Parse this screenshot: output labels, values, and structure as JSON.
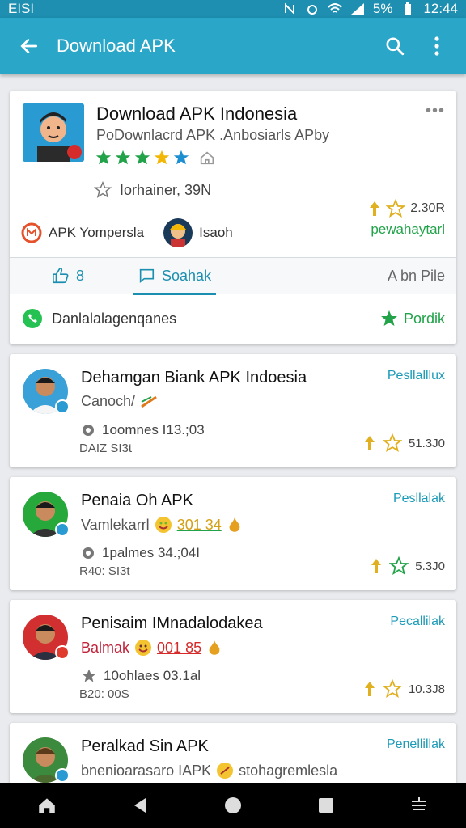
{
  "status": {
    "carrier": "ЕISI",
    "battery": "5%",
    "time": "12:44"
  },
  "appbar": {
    "title": "Download APK",
    "back_icon": "arrow-left-icon",
    "search_icon": "search-icon",
    "menu_icon": "more-vert-icon"
  },
  "featured": {
    "title": "Download APK Indonesia",
    "subtitle": "PoDownlacrd APK .Anbosiarls APby",
    "rating_stars": 5,
    "more": "•••",
    "follow_label": "Iorhainer, 39N",
    "developer1": "APK Yompersla",
    "developer2": "Isaoh",
    "stat_value": "2.30R",
    "stat_sub": "pewahaytarl",
    "tabs": [
      {
        "label": "8"
      },
      {
        "label": "Soahak"
      },
      {
        "label": "A bn Pile"
      }
    ],
    "bottom_label": "Danlalalagenqanes",
    "bottom_action": "Pordik"
  },
  "items": [
    {
      "name": "Dehamgan Biank APK Indoesia",
      "line2": "Canoch/",
      "line2_colored": "",
      "meta1": "1oomnes I13.;03",
      "meta2": "DAIZ SI3t",
      "link": "Pesllalllux",
      "stat": "51.3J0",
      "badge_color": "#2a9ad3",
      "accent": "#22a34a"
    },
    {
      "name": "Penaia Oh APK",
      "line2": "Vamlekarrl",
      "line2_colored": "301 34",
      "meta1": "1palmes 34.;04I",
      "meta2": "R40: SI3t",
      "link": "Pesllalak",
      "stat": "5.3J0",
      "badge_color": "#2a9ad3",
      "accent": "#d4a017"
    },
    {
      "name": "Penisaim IMnadalodakea",
      "line2": "Balmak",
      "line2_colored": "001 85",
      "meta1": "10ohlaes 03.1al",
      "meta2": "B20: 00S",
      "link": "Pecallilak",
      "stat": "10.3J8",
      "badge_color": "#e03a2e",
      "accent": "#d42a2a"
    },
    {
      "name": "Peralkad Sin APK",
      "line2": "bnenioarasaro IAPK",
      "line2_colored": "stohagremlesla",
      "meta1": "",
      "meta2": "",
      "link": "Penellillak",
      "stat": "",
      "badge_color": "#2a9ad3",
      "accent": "#22a34a"
    }
  ],
  "nav": {
    "home_icon": "home-icon",
    "back_icon": "back-triangle-icon",
    "circle_icon": "home-circle-icon",
    "recent_icon": "recents-square-icon",
    "extra_icon": "keyboard-switch-icon"
  }
}
